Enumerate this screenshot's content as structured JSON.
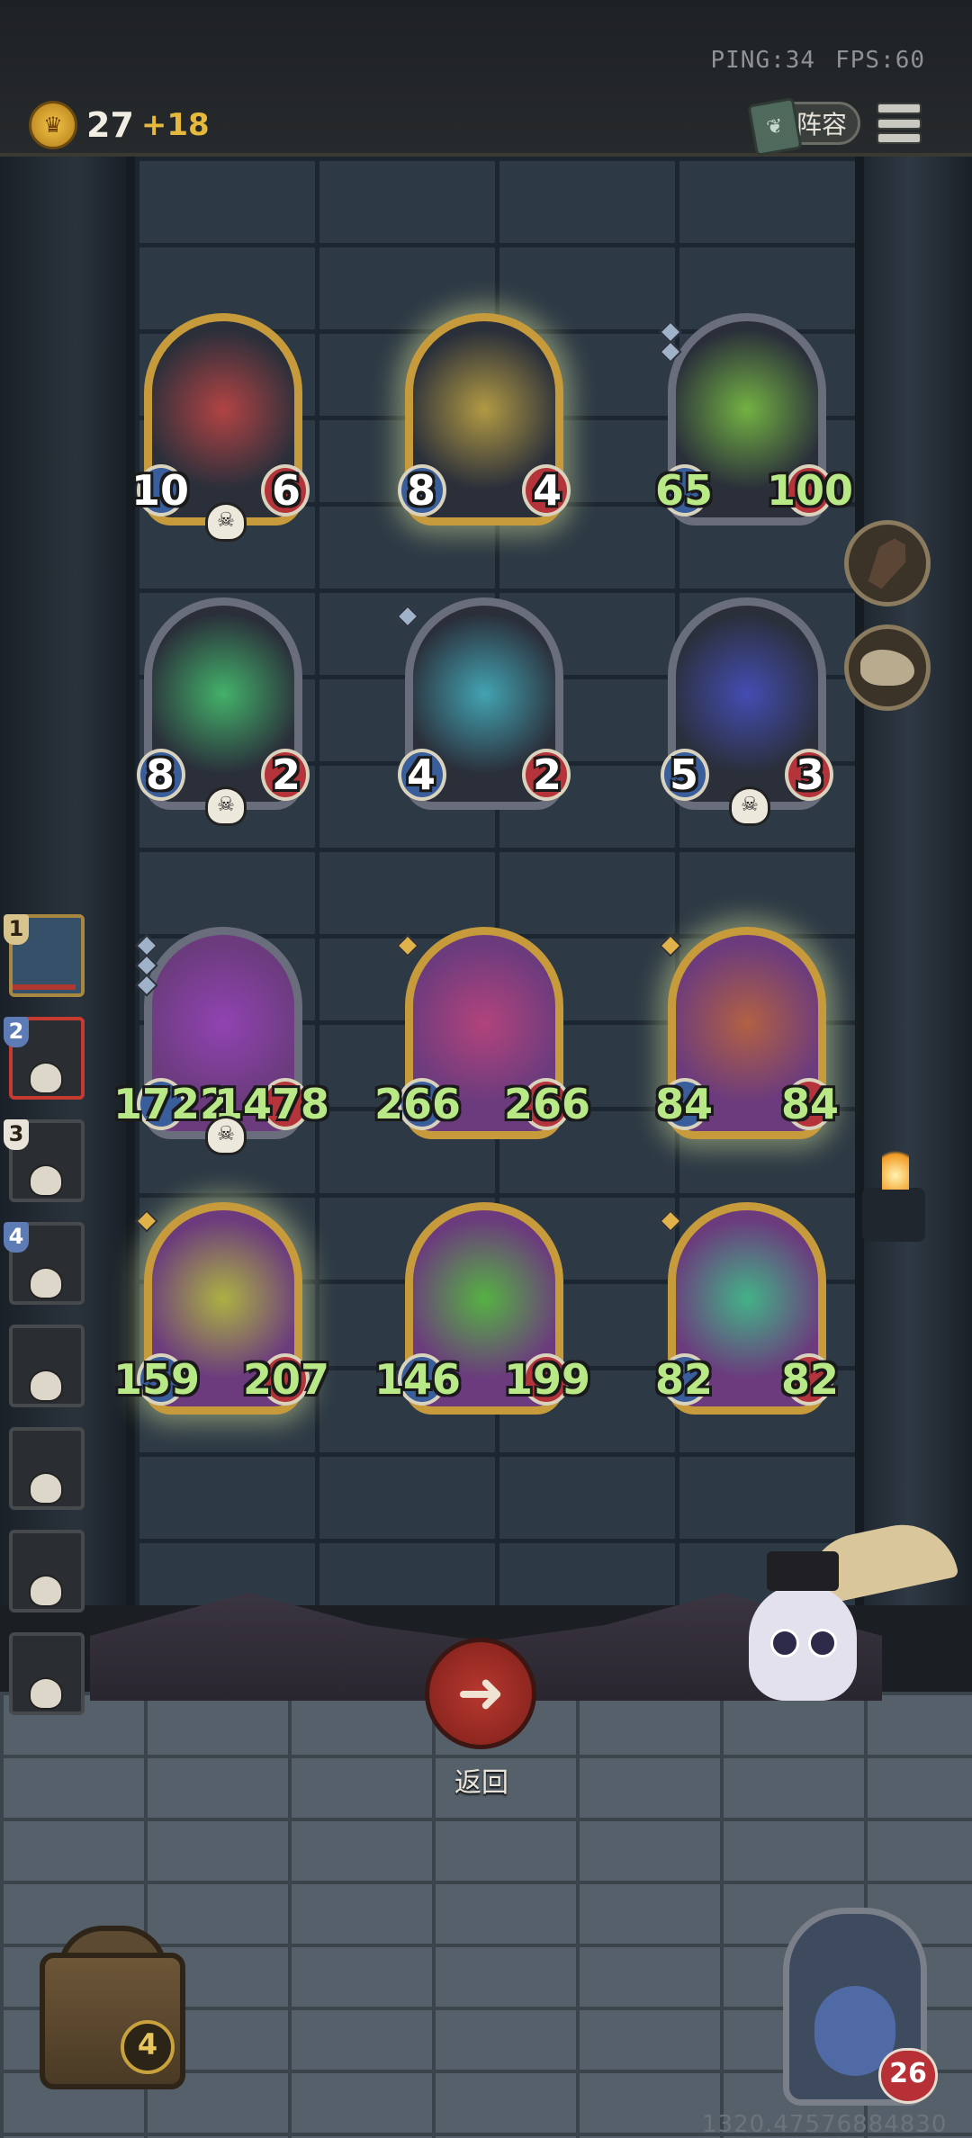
{
  "header": {
    "ping": "PING:34",
    "fps": "FPS:60",
    "gold": "27",
    "gold_income": "+18",
    "lineup_label": "阵容",
    "coin_icon": "crown-coin-icon",
    "menu_icon": "hamburger-menu-icon"
  },
  "board": {
    "cards": [
      {
        "id": "red-dragon-1",
        "atk": "10",
        "hp": "6",
        "style": "gold",
        "stat_color": "white",
        "skull": true,
        "diamonds": 0
      },
      {
        "id": "green-dragon",
        "atk": "8",
        "hp": "4",
        "style": "gold glow",
        "stat_color": "white",
        "skull": false,
        "diamonds": 0
      },
      {
        "id": "ice-dragon",
        "atk": "65",
        "hp": "100",
        "style": "silver",
        "stat_color": "green",
        "skull": false,
        "diamonds": 2
      },
      {
        "id": "shadow-dragon",
        "atk": "8",
        "hp": "2",
        "style": "silver",
        "stat_color": "white",
        "skull": true,
        "diamonds": 0
      },
      {
        "id": "bone-dragon",
        "atk": "4",
        "hp": "2",
        "style": "silver",
        "stat_color": "white",
        "skull": false,
        "diamonds": 1
      },
      {
        "id": "red-dragon-2",
        "atk": "5",
        "hp": "3",
        "style": "silver",
        "stat_color": "white",
        "skull": true,
        "diamonds": 0
      },
      {
        "id": "green-ghost-pirate",
        "atk": "1722",
        "hp": "1478",
        "style": "purple",
        "stat_color": "green",
        "skull": true,
        "diamonds": 3
      },
      {
        "id": "skeleton-ghost",
        "atk": "266",
        "hp": "266",
        "style": "gold purple",
        "stat_color": "green",
        "skull": false,
        "diamonds": 1
      },
      {
        "id": "apple-frog-1",
        "atk": "84",
        "hp": "84",
        "style": "gold purple glow",
        "stat_color": "green",
        "skull": false,
        "diamonds": 1
      },
      {
        "id": "spirit-wolf",
        "atk": "159",
        "hp": "207",
        "style": "gold purple glow",
        "stat_color": "green",
        "skull": false,
        "diamonds": 1
      },
      {
        "id": "ghost-giant",
        "atk": "146",
        "hp": "199",
        "style": "gold purple",
        "stat_color": "green",
        "skull": false,
        "diamonds": 0
      },
      {
        "id": "apple-frog-2",
        "atk": "82",
        "hp": "82",
        "style": "gold purple",
        "stat_color": "green",
        "skull": false,
        "diamonds": 1
      }
    ]
  },
  "side_buttons": [
    {
      "icon": "coffin-icon"
    },
    {
      "icon": "fossil-skull-icon"
    }
  ],
  "roster": [
    {
      "num": "1",
      "state": "first"
    },
    {
      "num": "2",
      "state": "active"
    },
    {
      "num": "3",
      "state": "normal"
    },
    {
      "num": "4",
      "state": "normal"
    },
    {
      "num": "",
      "state": "normal"
    },
    {
      "num": "",
      "state": "normal"
    },
    {
      "num": "",
      "state": "normal"
    },
    {
      "num": "",
      "state": "normal"
    }
  ],
  "back": {
    "label": "返回",
    "icon": "back-arrow-icon"
  },
  "footer": {
    "chest_level": "4",
    "hero_health": "26",
    "coordinate": "1320.47576884830"
  },
  "colors": {
    "accent_gold": "#c79a3c",
    "atk_blue": "#3a5d9c",
    "hp_red": "#b5333a",
    "buffed_stat": "#b8e986"
  }
}
